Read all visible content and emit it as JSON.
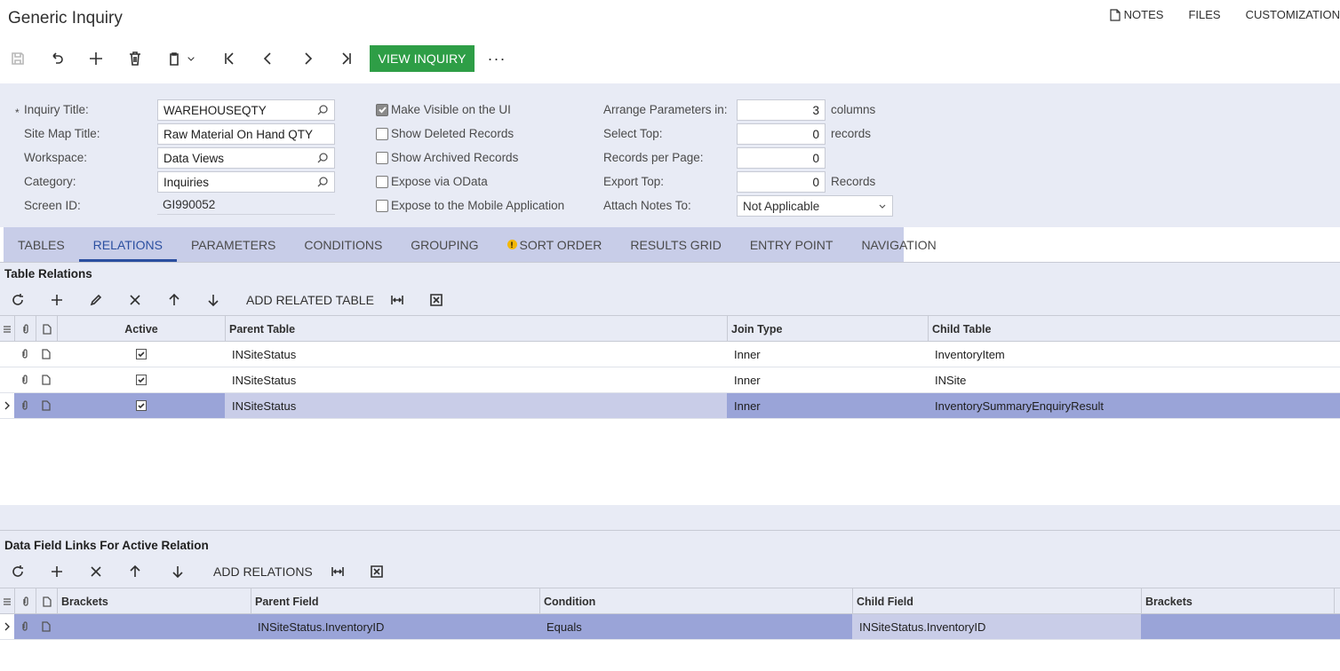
{
  "page": {
    "title": "Generic Inquiry",
    "links": {
      "notes": "NOTES",
      "files": "FILES",
      "customization": "CUSTOMIZATION"
    }
  },
  "toolbar": {
    "view_inquiry": "VIEW INQUIRY",
    "more": "···"
  },
  "form": {
    "inquiry_title_label": "Inquiry Title:",
    "inquiry_title_value": "WAREHOUSEQTY",
    "site_map_title_label": "Site Map Title:",
    "site_map_title_value": "Raw Material On Hand QTY",
    "workspace_label": "Workspace:",
    "workspace_value": "Data Views",
    "category_label": "Category:",
    "category_value": "Inquiries",
    "screen_id_label": "Screen ID:",
    "screen_id_value": "GI990052",
    "make_visible": "Make Visible on the UI",
    "show_deleted": "Show Deleted Records",
    "show_archived": "Show Archived Records",
    "expose_odata": "Expose via OData",
    "expose_mobile": "Expose to the Mobile Application",
    "arrange_label": "Arrange Parameters in:",
    "arrange_value": "3",
    "arrange_unit": "columns",
    "select_top_label": "Select Top:",
    "select_top_value": "0",
    "select_top_unit": "records",
    "records_per_page_label": "Records per Page:",
    "records_per_page_value": "0",
    "export_top_label": "Export Top:",
    "export_top_value": "0",
    "export_top_unit": "Records",
    "attach_notes_label": "Attach Notes To:",
    "attach_notes_value": "Not Applicable"
  },
  "tabs": [
    "TABLES",
    "RELATIONS",
    "PARAMETERS",
    "CONDITIONS",
    "GROUPING",
    "SORT ORDER",
    "RESULTS GRID",
    "ENTRY POINT",
    "NAVIGATION"
  ],
  "relations": {
    "section_title": "Table Relations",
    "add_button": "ADD RELATED TABLE",
    "headers": {
      "active": "Active",
      "parent": "Parent Table",
      "join": "Join Type",
      "child": "Child Table"
    },
    "rows": [
      {
        "active": true,
        "parent": "INSiteStatus",
        "join": "Inner",
        "child": "InventoryItem"
      },
      {
        "active": true,
        "parent": "INSiteStatus",
        "join": "Inner",
        "child": "INSite"
      },
      {
        "active": true,
        "parent": "INSiteStatus",
        "join": "Inner",
        "child": "InventorySummaryEnquiryResult"
      }
    ]
  },
  "links": {
    "section_title": "Data Field Links For Active Relation",
    "add_button": "ADD RELATIONS",
    "headers": {
      "brackets_open": "Brackets",
      "parent": "Parent Field",
      "condition": "Condition",
      "child": "Child Field",
      "brackets_close": "Brackets"
    },
    "rows": [
      {
        "brackets_open": "",
        "parent": "INSiteStatus.InventoryID",
        "condition": "Equals",
        "child": "INSiteStatus.InventoryID",
        "brackets_close": ""
      }
    ]
  }
}
